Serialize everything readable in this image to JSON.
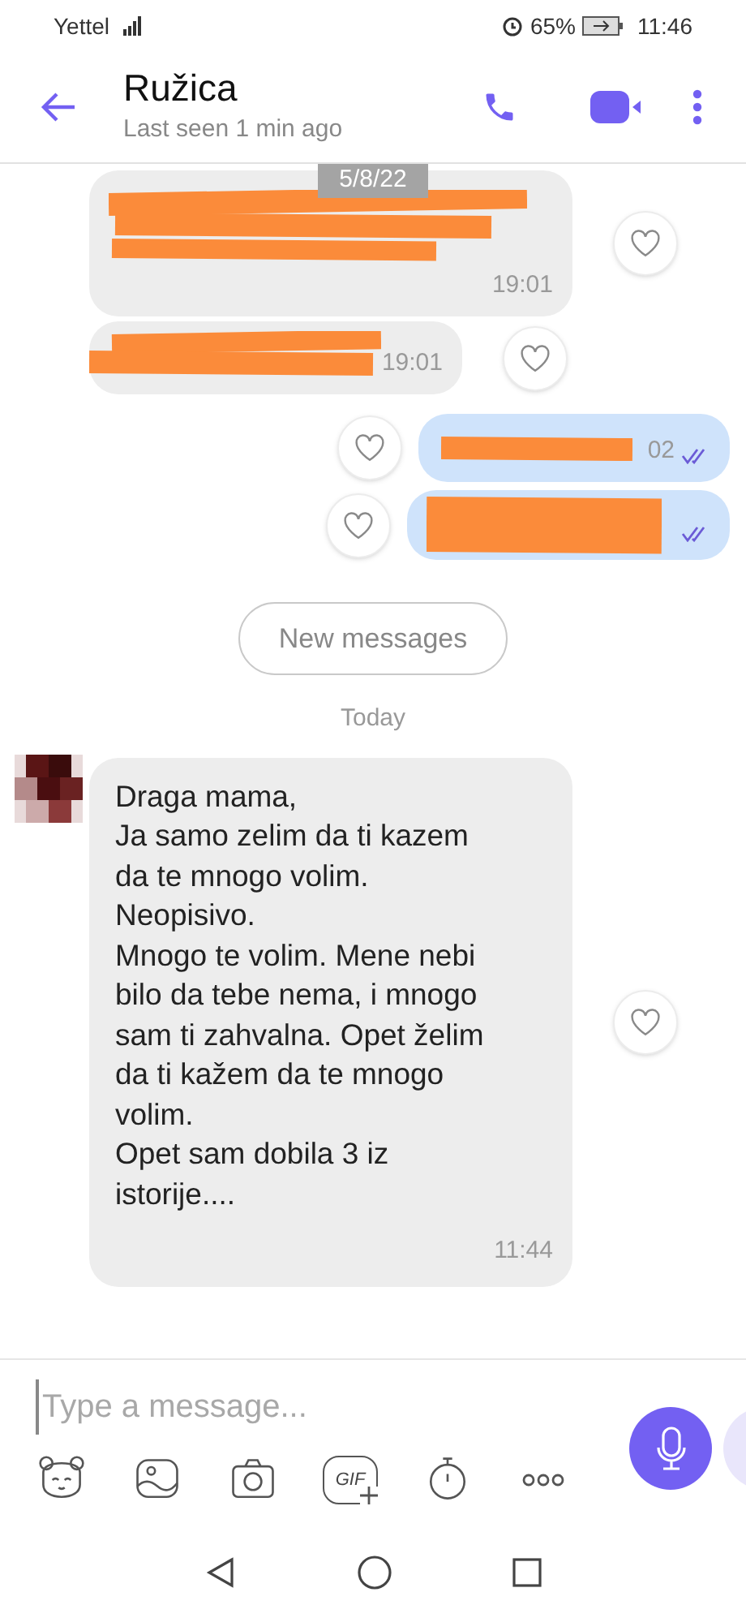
{
  "status_bar": {
    "carrier": "Yettel",
    "battery": "65%",
    "time": "11:46"
  },
  "header": {
    "name": "Ružica",
    "last_seen": "Last seen 1 min ago"
  },
  "date_chip": "5/8/22",
  "redacted_messages": [
    {
      "kind": "incoming",
      "time": "19:01"
    },
    {
      "kind": "incoming",
      "time": "19:01"
    },
    {
      "kind": "outgoing",
      "time": "02",
      "read": true
    },
    {
      "kind": "outgoing",
      "read": true
    }
  ],
  "new_messages_button": "New messages",
  "day_divider": "Today",
  "message": {
    "text": "Draga mama,\nJa samo zelim da ti kazem\nda te mnogo volim.\nNeopisivo.\nMnogo te volim. Mene nebi\nbilo da tebe nema, i mnogo\nsam ti zahvalna. Opet želim\nda ti kažem da te mnogo\nvolim.\nOpet sam dobila 3 iz\nistorije....",
    "time": "11:44"
  },
  "composer": {
    "placeholder": "Type a message...",
    "gif_label": "GIF"
  }
}
